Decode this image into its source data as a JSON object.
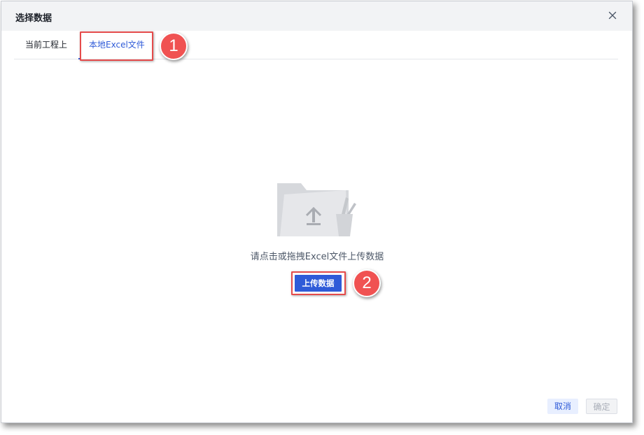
{
  "dialog": {
    "title": "选择数据",
    "close_icon": "close-icon"
  },
  "tabs": [
    {
      "label": "当前工程上",
      "active": false
    },
    {
      "label": "本地Excel文件",
      "active": true
    }
  ],
  "annotations": {
    "badge_1": "1",
    "badge_2": "2"
  },
  "upload": {
    "illustration_icon": "folder-upload-icon",
    "hint": "请点击或拖拽Excel文件上传数据",
    "button_label": "上传数据"
  },
  "footer": {
    "cancel_label": "取消",
    "confirm_label": "确定",
    "confirm_disabled": true
  },
  "colors": {
    "accent": "#2f5bd8",
    "callout_red": "#e54b4b",
    "header_bg": "#f2f3f5"
  }
}
